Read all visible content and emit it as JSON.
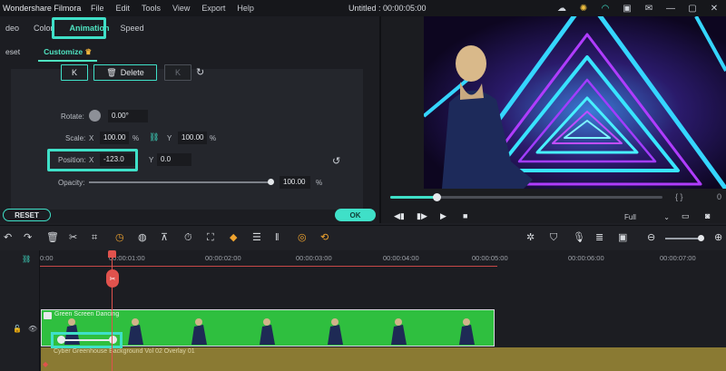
{
  "titlebar": {
    "app_name": "Wondershare Filmora",
    "menu": [
      "File",
      "Edit",
      "Tools",
      "View",
      "Export",
      "Help"
    ],
    "window_title": "Untitled : 00:00:05:00"
  },
  "tabs": {
    "video": "deo",
    "color": "Color",
    "animation": "Animation",
    "speed": "Speed"
  },
  "subtabs": {
    "preset": "eset",
    "customize": "Customize"
  },
  "keyframes": {
    "prev_label": "K",
    "delete_label": "Delete",
    "next_label": "K"
  },
  "props": {
    "rotate_label": "Rotate:",
    "rotate_value": "0.00°",
    "scale_label": "Scale:",
    "scale_x_label": "X",
    "scale_x_value": "100.00",
    "scale_x_unit": "%",
    "scale_y_label": "Y",
    "scale_y_value": "100.00",
    "scale_y_unit": "%",
    "position_label": "Position:",
    "pos_x_label": "X",
    "pos_x_value": "-123.0",
    "pos_y_label": "Y",
    "pos_y_value": "0.0",
    "opacity_label": "Opacity:",
    "opacity_value": "100.00",
    "opacity_unit": "%",
    "opacity_level": 1.0
  },
  "buttons": {
    "reset": "RESET",
    "ok": "OK"
  },
  "player": {
    "progress": 0.17,
    "brackets": "{    }",
    "time_tail": "0",
    "quality": "Full"
  },
  "timeline": {
    "ticks": [
      "0:00",
      "00:00:01:00",
      "00:00:02:00",
      "00:00:03:00",
      "00:00:04:00",
      "00:00:05:00",
      "00:00:06:00",
      "00:00:07:00"
    ],
    "clip_green_label": "Green Screen Dancing",
    "clip_yellow_label": "Cyber Greenhouse Background Vol 02 Overlay 01"
  },
  "colors": {
    "accent": "#3fe0c8",
    "playhead": "#e0524d",
    "clip_green": "#2fbf3f",
    "clip_yellow": "#8a7a33"
  }
}
